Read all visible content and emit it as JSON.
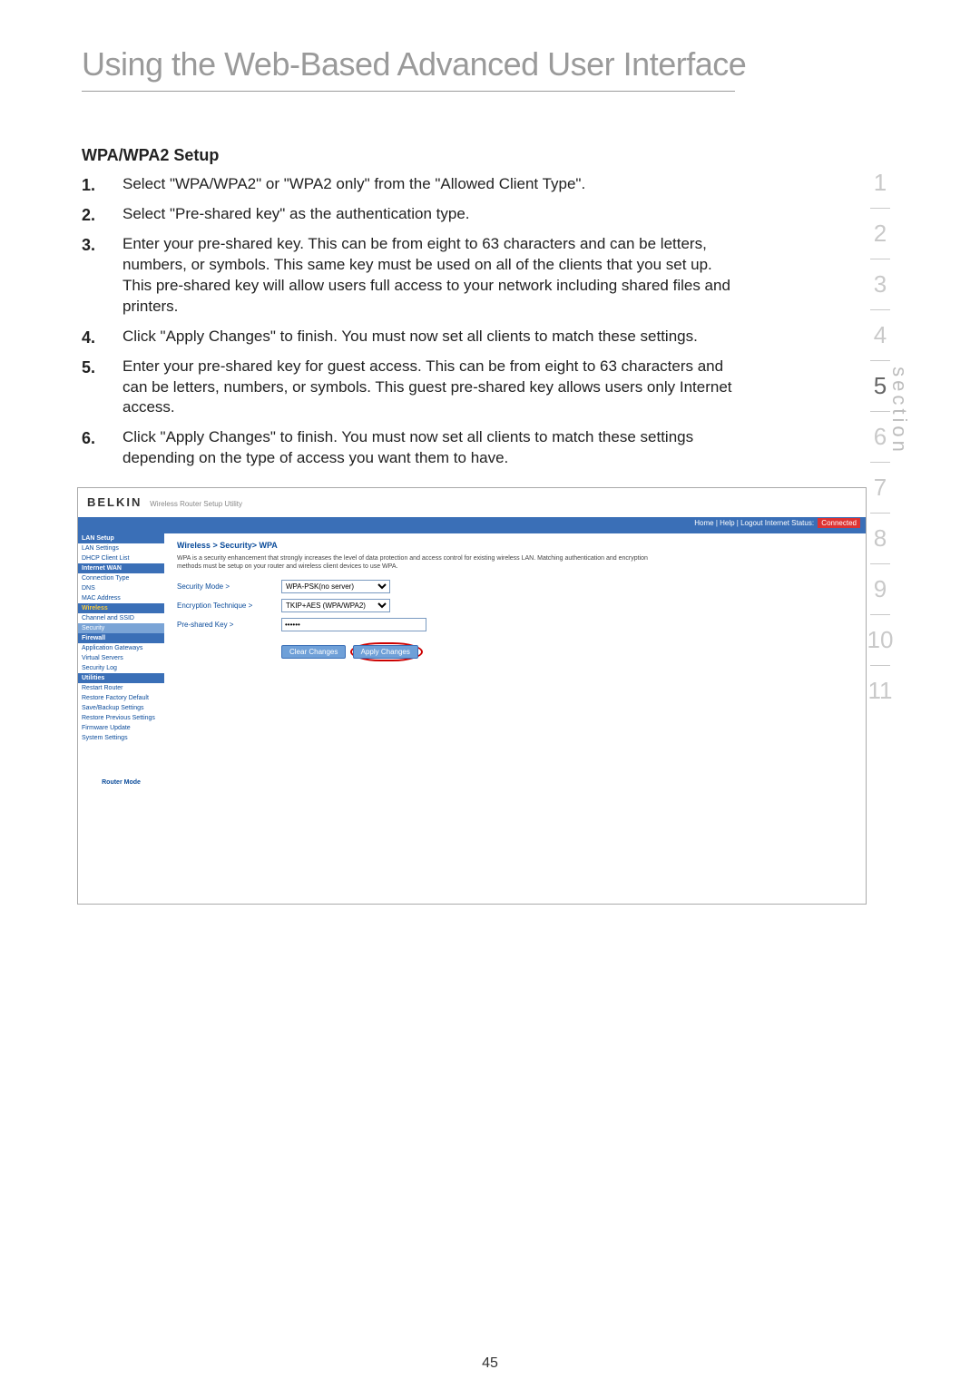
{
  "page": {
    "title": "Using the Web-Based Advanced User Interface",
    "number": "45"
  },
  "section": {
    "heading": "WPA/WPA2 Setup"
  },
  "steps": [
    "Select \"WPA/WPA2\" or \"WPA2 only\" from the \"Allowed Client Type\".",
    "Select \"Pre-shared key\" as the authentication type.",
    "Enter your pre-shared key. This can be from eight to 63 characters and can be letters, numbers, or symbols. This same key must be used on all of the clients that you set up. This pre-shared key will allow users full access to your network including shared files and printers.",
    "Click \"Apply Changes\" to finish. You must now set all clients to match these settings.",
    "Enter your pre-shared key for guest access. This can be from eight to 63 characters and can be letters, numbers, or symbols. This guest pre-shared key allows users only Internet access.",
    "Click \"Apply Changes\" to finish. You must now set all clients to match these settings depending on the type of access you want them to have."
  ],
  "sidenav": {
    "label": "section",
    "items": [
      "1",
      "2",
      "3",
      "4",
      "5",
      "6",
      "7",
      "8",
      "9",
      "10",
      "11"
    ],
    "active": "5"
  },
  "router": {
    "brand": "BELKIN",
    "model": "Wireless Router Setup Utility",
    "topbar": {
      "links": "Home | Help | Logout    Internet Status:",
      "status": "Connected"
    },
    "breadcrumb": "Wireless > Security> WPA",
    "desc": "WPA is a security enhancement that strongly increases the level of data protection and access control for existing wireless LAN. Matching authentication and encryption methods must be setup on your router and wireless client devices to use WPA.",
    "fields": {
      "securityMode": {
        "label": "Security Mode >",
        "value": "WPA-PSK(no server)"
      },
      "encryption": {
        "label": "Encryption Technique >",
        "value": "TKIP+AES (WPA/WPA2)"
      },
      "psk": {
        "label": "Pre-shared Key >",
        "value": "••••••"
      }
    },
    "buttons": {
      "clear": "Clear Changes",
      "apply": "Apply Changes"
    },
    "nav": {
      "groups": [
        {
          "title": "LAN Setup",
          "items": [
            "LAN Settings",
            "DHCP Client List"
          ]
        },
        {
          "title": "Internet WAN",
          "items": [
            "Connection Type",
            "DNS",
            "MAC Address"
          ]
        },
        {
          "title": "Wireless",
          "items": [
            "Channel and SSID",
            "Security"
          ],
          "highlightTitle": true,
          "active": "Security"
        },
        {
          "title": "Firewall",
          "items": [
            "Application Gateways",
            "Virtual Servers",
            "Security Log"
          ]
        },
        {
          "title": "Utilities",
          "items": [
            "Restart Router",
            "Restore Factory Default",
            "Save/Backup Settings",
            "Restore Previous Settings",
            "Firmware Update",
            "System Settings"
          ]
        }
      ],
      "mode": "Router Mode"
    }
  }
}
